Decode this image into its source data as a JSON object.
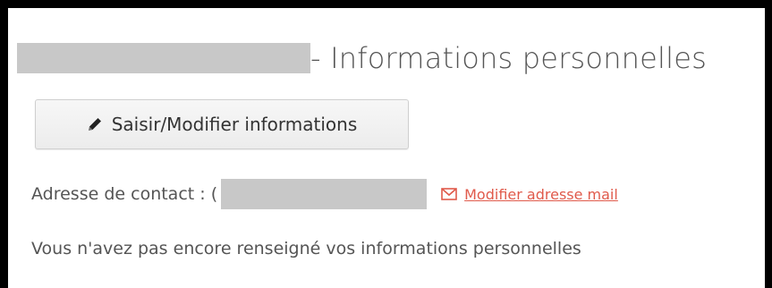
{
  "header": {
    "title": "- Informations personnelles"
  },
  "actions": {
    "edit_label": "Saisir/Modifier informations",
    "edit_icon": "pencil-icon"
  },
  "contact": {
    "label": "Adresse de contact : (",
    "modify_link": "Modifier adresse mail",
    "link_icon": "envelope-icon"
  },
  "info": {
    "message": "Vous n'avez pas encore renseigné vos informations personnelles"
  },
  "colors": {
    "link": "#e05a4b",
    "text": "#555555",
    "redaction": "#c8c8c8"
  }
}
